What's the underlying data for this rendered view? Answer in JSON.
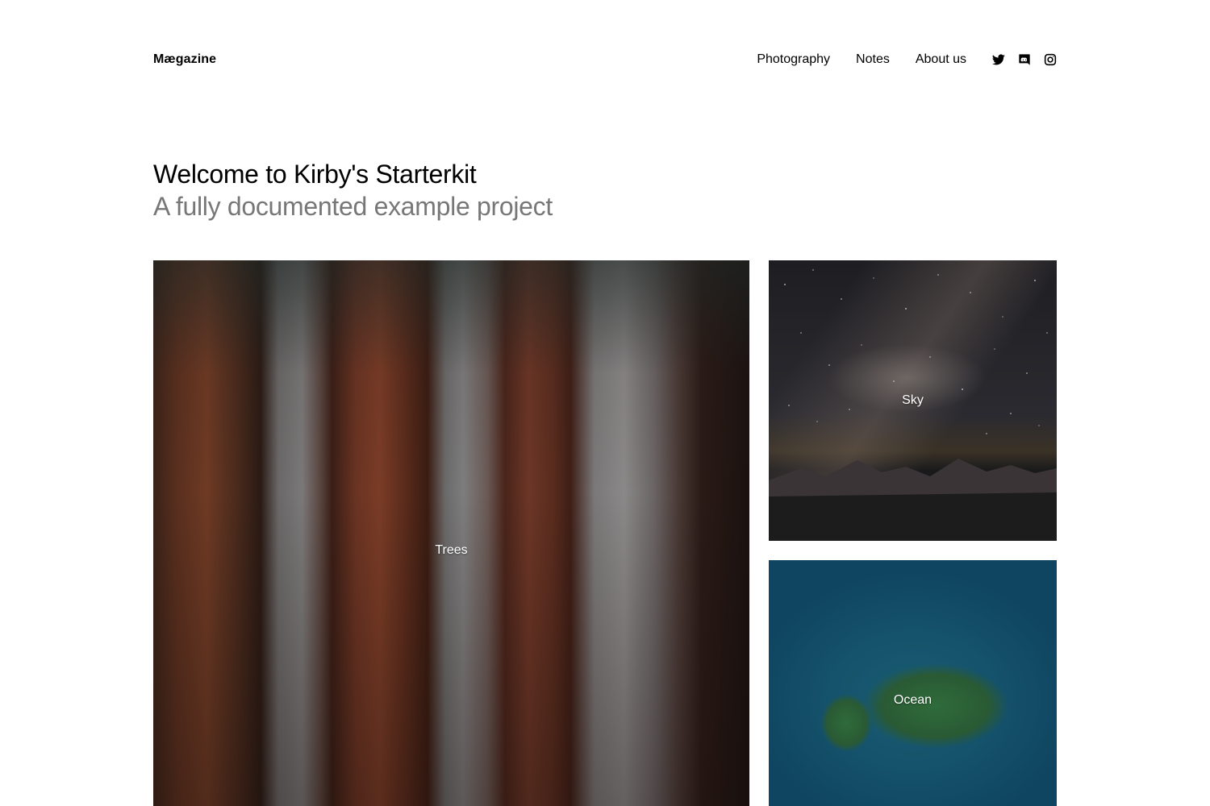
{
  "header": {
    "logo": "Mægazine",
    "nav": [
      {
        "label": "Photography"
      },
      {
        "label": "Notes"
      },
      {
        "label": "About us"
      }
    ],
    "social": [
      {
        "icon": "twitter-icon"
      },
      {
        "icon": "discord-icon"
      },
      {
        "icon": "instagram-icon"
      }
    ]
  },
  "intro": {
    "title": "Welcome to Kirby's Starterkit",
    "subtitle": "A fully documented example project"
  },
  "gallery": [
    {
      "label": "Trees"
    },
    {
      "label": "Sky"
    },
    {
      "label": "Ocean"
    }
  ],
  "colors": {
    "text": "#000000",
    "subtitle": "#777777",
    "background": "#ffffff",
    "tile_label": "#ffffff"
  }
}
